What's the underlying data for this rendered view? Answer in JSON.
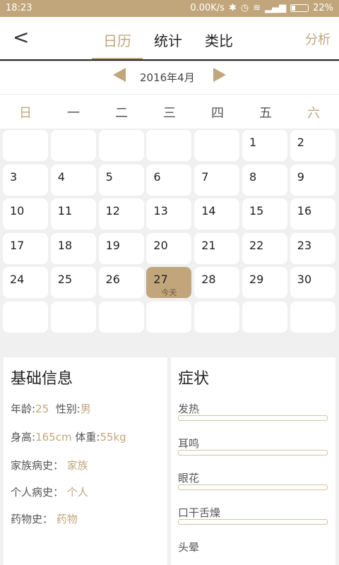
{
  "status": {
    "time": "18:23",
    "speed": "0.00K/s",
    "battery": "22%",
    "battery_level": 0.22
  },
  "header": {
    "tabs": [
      "日历",
      "统计",
      "类比"
    ],
    "active": 0,
    "analyze": "分析"
  },
  "month": {
    "label": "2016年4月"
  },
  "weekdays": [
    "日",
    "一",
    "二",
    "三",
    "四",
    "五",
    "六"
  ],
  "calendar": {
    "days": [
      "",
      "",
      "",
      "",
      "",
      "1",
      "2",
      "3",
      "4",
      "5",
      "6",
      "7",
      "8",
      "9",
      "10",
      "11",
      "12",
      "13",
      "14",
      "15",
      "16",
      "17",
      "18",
      "19",
      "20",
      "21",
      "22",
      "23",
      "24",
      "25",
      "26",
      "27",
      "28",
      "29",
      "30",
      "",
      "",
      "",
      "",
      "",
      "",
      ""
    ],
    "today_day": "27",
    "today_label": "今天"
  },
  "basic": {
    "title": "基础信息",
    "age_label": "年龄:",
    "age_value": "25",
    "sex_label": "性别:",
    "sex_value": "男",
    "height_label": "身高:",
    "height_value": "165cm",
    "weight_label": "体重:",
    "weight_value": "55kg",
    "family_label": "家族病史：",
    "family_value": "家族",
    "personal_label": "个人病史：",
    "personal_value": "个人",
    "drug_label": "药物史：",
    "drug_value": "药物"
  },
  "symptoms": {
    "title": "症状",
    "items": [
      "发热",
      "耳鸣",
      "眼花",
      "口干舌燥",
      "头晕"
    ]
  }
}
